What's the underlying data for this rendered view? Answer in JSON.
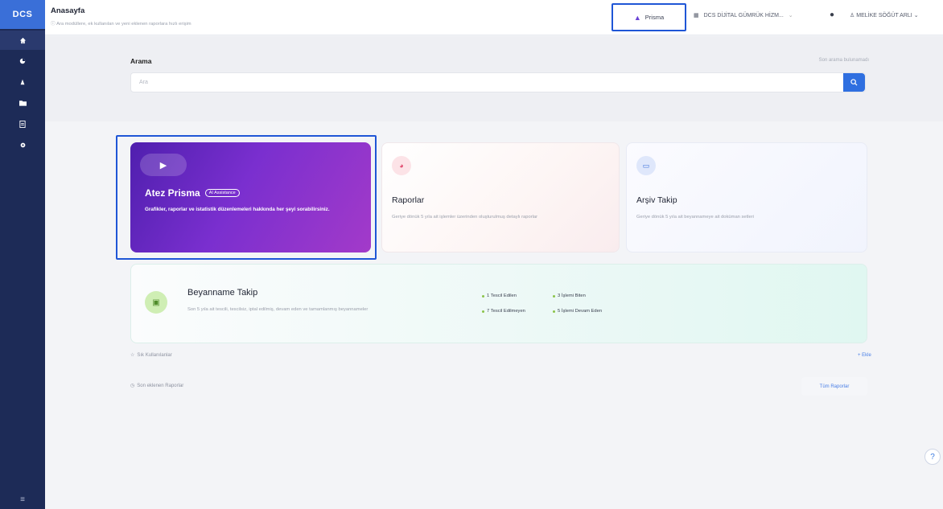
{
  "sidebar": {
    "logo": "DCS",
    "items": [
      {
        "icon": "home-icon"
      },
      {
        "icon": "pie-chart-icon"
      },
      {
        "icon": "prisma-icon"
      },
      {
        "icon": "folder-icon"
      },
      {
        "icon": "document-icon"
      },
      {
        "icon": "settings-icon"
      }
    ],
    "bottom_icon": "menu-icon"
  },
  "topbar": {
    "title": "Anasayfa",
    "subtitle": "Ara modüllere, ek kullanılan ve yeni eklenen raporlara hızlı erişim",
    "prisma_label": "Prisma",
    "company": "DCS DİJİTAL GÜMRÜK HİZM...",
    "user": "MELİKE SÖĞÜT ARLI"
  },
  "search": {
    "label": "Arama",
    "hint": "Son arama bulunamadı",
    "placeholder": "Ara"
  },
  "cards": {
    "prisma": {
      "title": "Atez Prisma",
      "badge": "AI Assistance",
      "desc": "Grafikler, raporlar ve istatistik düzenlemeleri hakkında her şeyi sorabilirsiniz."
    },
    "raporlar": {
      "title": "Raporlar",
      "desc": "Geriye dönük 5 yıla ait işlemler üzerinden oluşturulmuş detaylı raporlar"
    },
    "arsiv": {
      "title": "Arşiv Takip",
      "desc": "Geriye dönük 5 yıla ait beyannameye ait doküman setleri"
    },
    "beyanname": {
      "title": "Beyanname Takip",
      "desc": "Son 5 yıla ait tescili, tescilsiz, iptal edilmiş, devam eden ve tamamlanmış beyannameler",
      "stats": [
        "1 Tescil Edilen",
        "3 İşlemi Biten",
        "7 Tescil Edilmeyen",
        "5 İşlemi Devam Eden"
      ]
    }
  },
  "sections": {
    "frequent": "Sık Kullanılanlar",
    "frequent_link": "+ Ekle",
    "recent": "Son eklenen Raporlar",
    "all_reports": "Tüm Raporlar"
  }
}
